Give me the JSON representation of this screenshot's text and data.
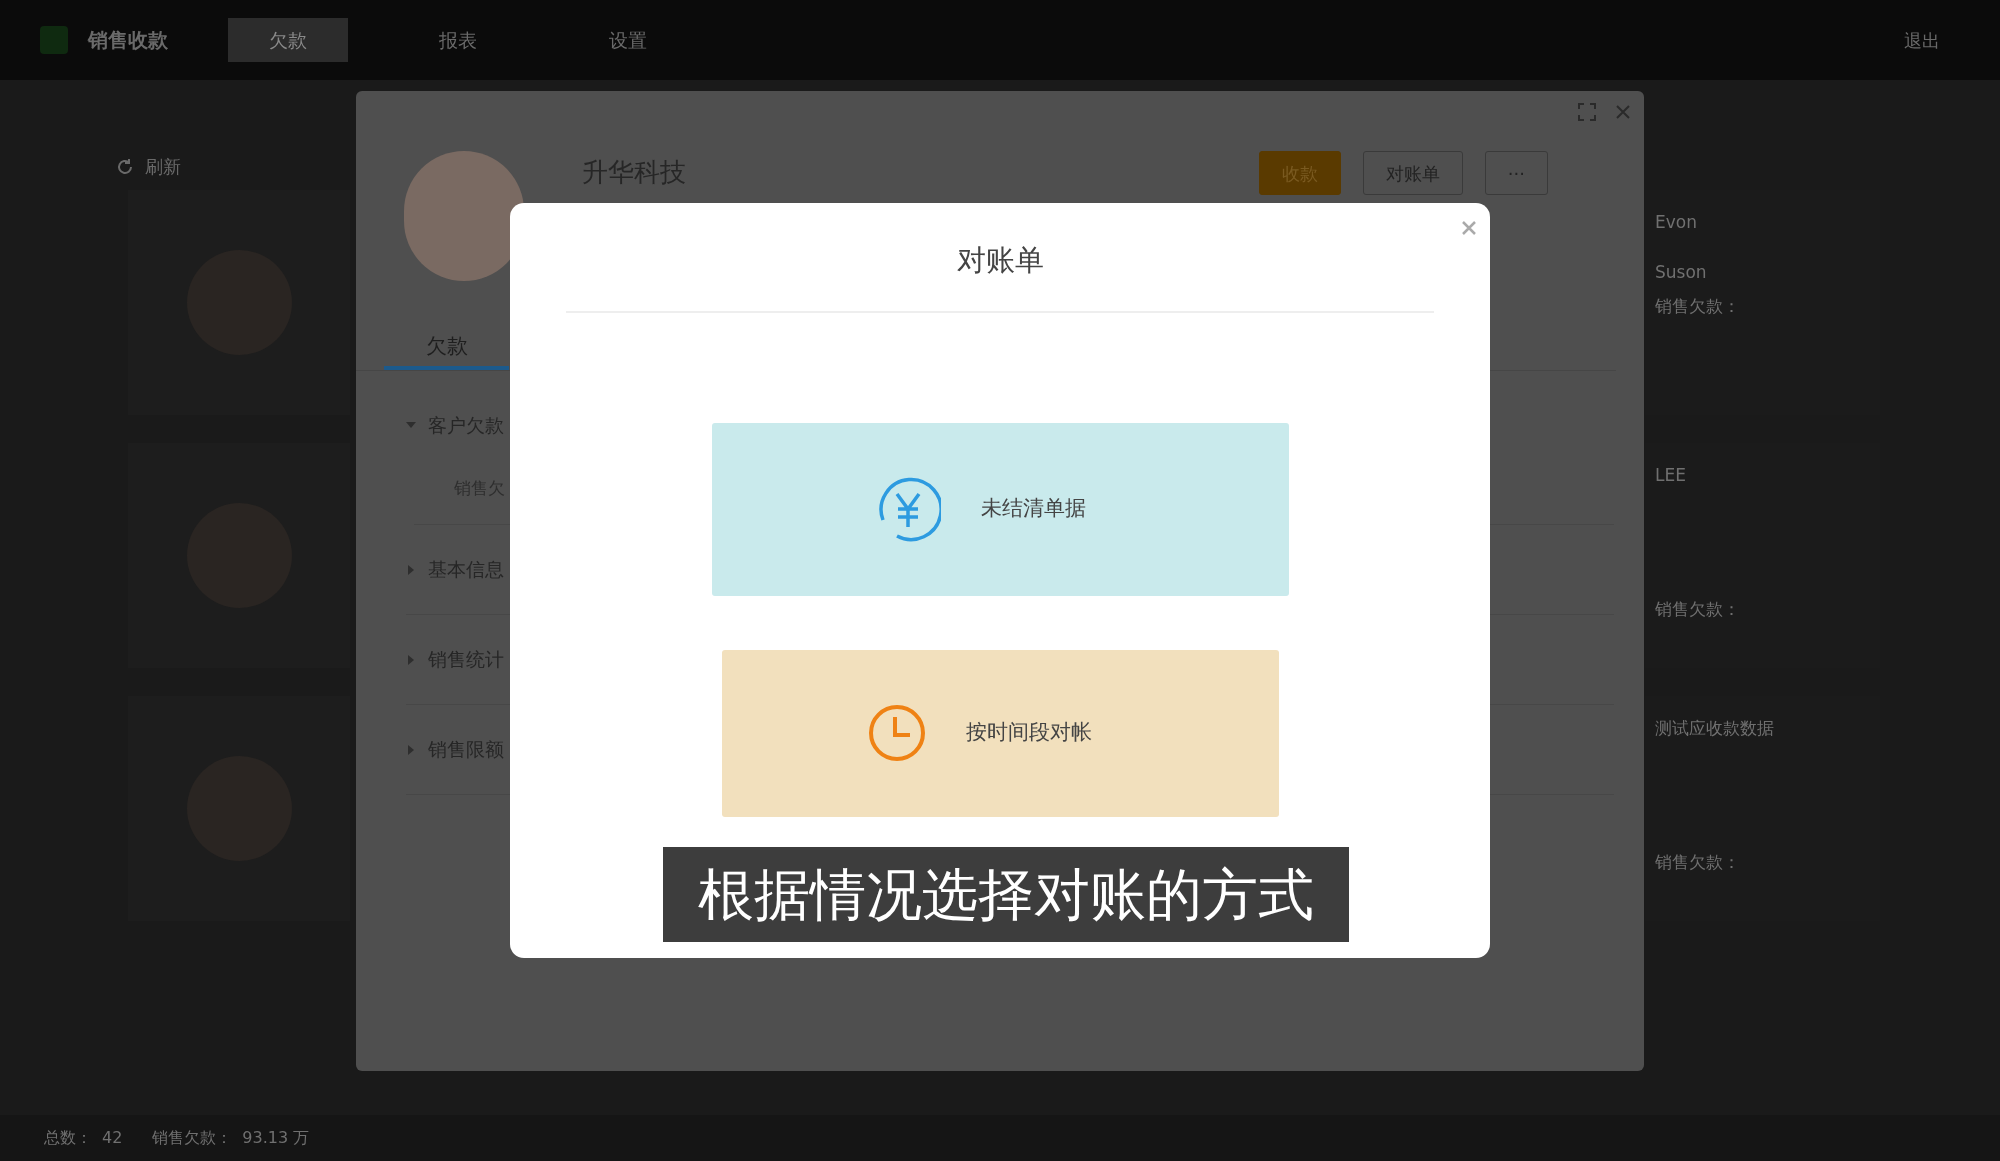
{
  "app_bar": {
    "title": "销售收款",
    "menu": [
      {
        "label": "欠款",
        "selected": true
      },
      {
        "label": "报表",
        "selected": false
      },
      {
        "label": "设置",
        "selected": false
      }
    ],
    "logout": "退出"
  },
  "toolbar": {
    "refresh": "刷新"
  },
  "customer_cards": [
    {
      "name": "Evon",
      "contact": "Suson",
      "debt_label": "销售欠款："
    },
    {
      "name": "LEE",
      "debt_label": "销售欠款："
    },
    {
      "name": "测试应收款数据",
      "debt_label": "销售欠款："
    }
  ],
  "status_bar": {
    "count_label": "总数：",
    "count": "42",
    "debt_label": "销售欠款：",
    "debt": "93.13 万"
  },
  "customer_panel": {
    "name": "升华科技",
    "buttons": [
      {
        "label": "收款",
        "kind": "primary"
      },
      {
        "label": "对账单",
        "kind": "default"
      },
      {
        "label": "···",
        "kind": "default"
      }
    ],
    "tabs": [
      {
        "label": "欠款",
        "selected": true
      }
    ],
    "sections": [
      {
        "label": "客户欠款",
        "expanded": true,
        "children": [
          {
            "label": "销售欠"
          }
        ]
      },
      {
        "label": "基本信息",
        "expanded": false
      },
      {
        "label": "销售统计",
        "expanded": false
      },
      {
        "label": "销售限额",
        "expanded": false
      }
    ]
  },
  "dialog": {
    "title": "对账单",
    "options": [
      {
        "label": "未结清单据",
        "kind": "unsettled"
      },
      {
        "label": "按时间段对帐",
        "kind": "period"
      }
    ]
  },
  "caption": "根据情况选择对账的方式"
}
